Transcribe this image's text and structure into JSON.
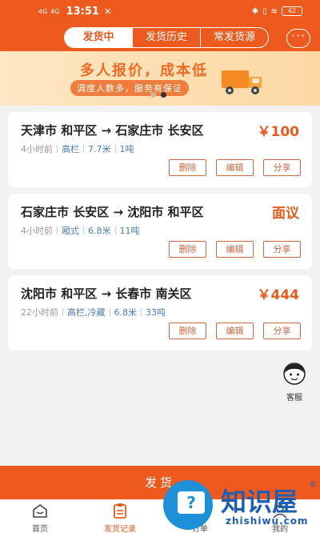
{
  "status_bar": {
    "signal_1": "4G",
    "signal_2": "4G",
    "time": "13:51",
    "battery": "42"
  },
  "header": {
    "tabs": [
      "发货中",
      "发货历史",
      "常发货源"
    ],
    "more": "···"
  },
  "banner": {
    "title": "多人报价，成本低",
    "subtitle": "调度人数多，服务有保证",
    "slide_count": 2,
    "active_slide": 2
  },
  "orders": [
    {
      "route": "天津市 和平区 → 石家庄市 长安区",
      "price": "￥100",
      "time": "4小时前",
      "tags": [
        "高栏",
        "7.7米",
        "1吨"
      ]
    },
    {
      "route": "石家庄市 长安区 → 沈阳市 和平区",
      "price": "面议",
      "time": "4小时前",
      "tags": [
        "厢式",
        "6.8米",
        "11吨"
      ]
    },
    {
      "route": "沈阳市 和平区 → 长春市 南关区",
      "price": "￥444",
      "time": "22小时前",
      "tags": [
        "高栏,冷藏",
        "6.8米",
        "33吨"
      ]
    }
  ],
  "actions": {
    "delete": "删除",
    "edit": "编辑",
    "share": "分享"
  },
  "customer_service": "客服",
  "main_button": "发货",
  "bottom_nav": [
    "首页",
    "发货记录",
    "订单",
    "我的"
  ],
  "watermark": {
    "brand": "知识屋",
    "url": "zhishiwu.com",
    "mark": "®"
  },
  "colors": {
    "accent": "#ee5a1e",
    "price": "#e85b1c",
    "tag": "#4a7bb7"
  }
}
